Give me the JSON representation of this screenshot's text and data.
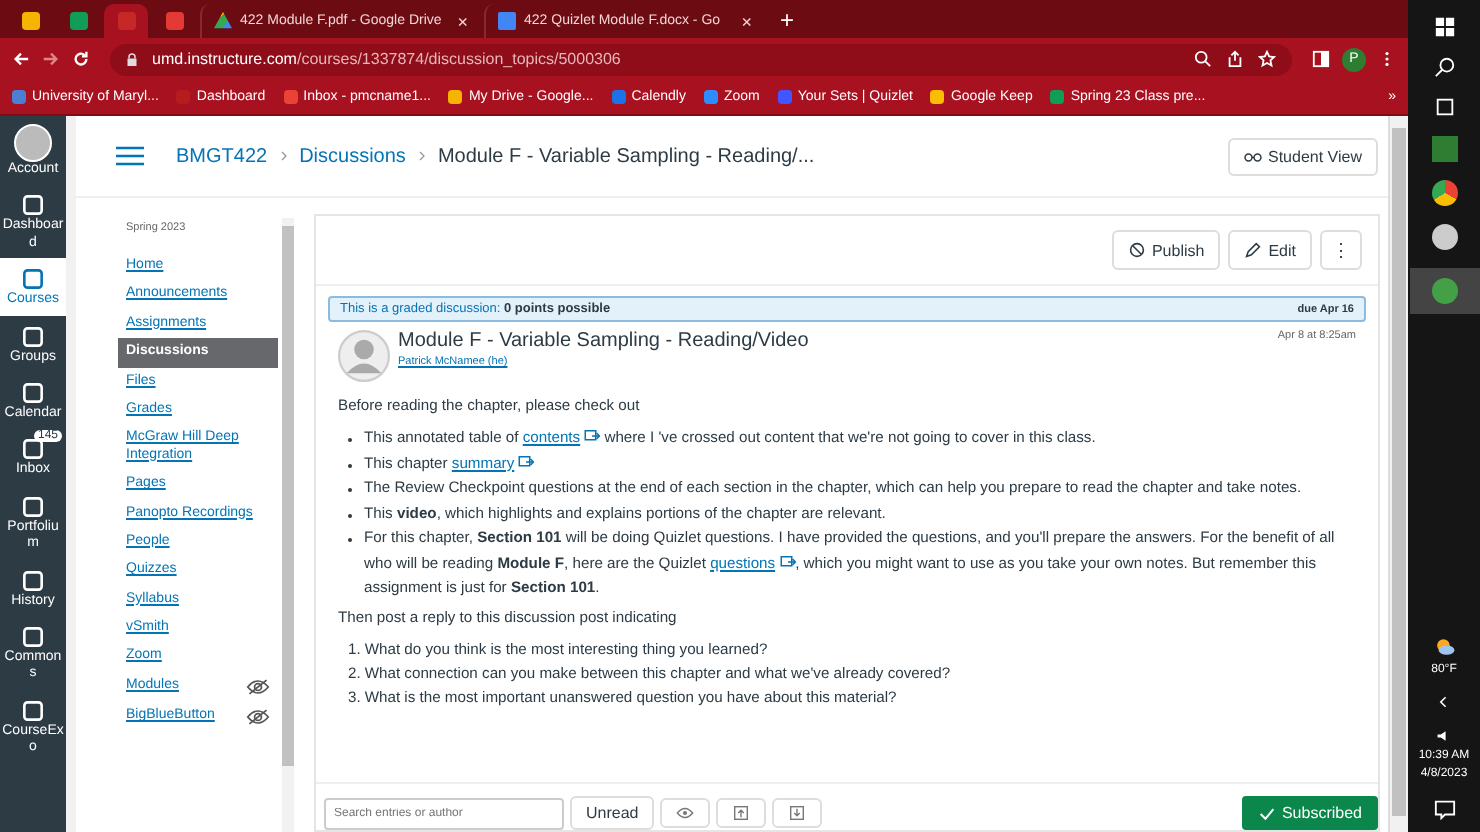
{
  "browser": {
    "tabs": [
      {
        "kind": "pinned",
        "selected": false
      },
      {
        "kind": "pinned",
        "selected": false
      },
      {
        "kind": "pinned",
        "selected": true
      },
      {
        "kind": "pinned",
        "selected": false
      },
      {
        "kind": "normal",
        "selected": false,
        "title": "422 Module F.pdf - Google Drive"
      },
      {
        "kind": "normal",
        "selected": false,
        "title": "422 Quizlet Module F.docx - Go"
      }
    ],
    "new_tab": "+",
    "close_glyph": "×",
    "address": {
      "host": "umd.instructure.com",
      "path": "/courses/1337874/discussion_topics/5000306"
    },
    "profile": "P",
    "bookmarks": [
      "University of Maryl...",
      "Dashboard",
      "Inbox - pmcname1...",
      "My Drive - Google...",
      "Calendly",
      "Zoom",
      "Your Sets | Quizlet",
      "Google Keep",
      "Spring 23 Class pre..."
    ],
    "bookmarks_more": "»"
  },
  "global_nav": [
    {
      "label": "Account",
      "selected": false
    },
    {
      "label": "Dashboard",
      "selected": false
    },
    {
      "label": "Courses",
      "selected": true
    },
    {
      "label": "Groups",
      "selected": false
    },
    {
      "label": "Calendar",
      "selected": false
    },
    {
      "label": "Inbox",
      "selected": false,
      "badge": "145"
    },
    {
      "label": "Portfolium",
      "selected": false
    },
    {
      "label": "History",
      "selected": false
    },
    {
      "label": "Commons",
      "selected": false
    },
    {
      "label": "CourseExo",
      "selected": false
    }
  ],
  "breadcrumb": [
    "BMGT422",
    "Discussions",
    "Module F - Variable Sampling - Reading/..."
  ],
  "student_view": "Student View",
  "course_nav": {
    "term": "Spring 2023",
    "items": [
      {
        "label": "Home",
        "selected": false,
        "hidden": false
      },
      {
        "label": "Announcements",
        "selected": false,
        "hidden": false
      },
      {
        "label": "Assignments",
        "selected": false,
        "hidden": false
      },
      {
        "label": "Discussions",
        "selected": true,
        "hidden": false
      },
      {
        "label": "Files",
        "selected": false,
        "hidden": false
      },
      {
        "label": "Grades",
        "selected": false,
        "hidden": false
      },
      {
        "label": "McGraw Hill Deep Integration",
        "selected": false,
        "hidden": false
      },
      {
        "label": "Pages",
        "selected": false,
        "hidden": false
      },
      {
        "label": "Panopto Recordings",
        "selected": false,
        "hidden": false
      },
      {
        "label": "People",
        "selected": false,
        "hidden": false
      },
      {
        "label": "Quizzes",
        "selected": false,
        "hidden": false
      },
      {
        "label": "Syllabus",
        "selected": false,
        "hidden": false
      },
      {
        "label": "vSmith",
        "selected": false,
        "hidden": false
      },
      {
        "label": "Zoom",
        "selected": false,
        "hidden": false
      },
      {
        "label": "Modules",
        "selected": false,
        "hidden": true
      },
      {
        "label": "BigBlueButton",
        "selected": false,
        "hidden": true
      }
    ]
  },
  "actions": {
    "publish": "Publish",
    "edit": "Edit",
    "more": "⋮"
  },
  "banner": {
    "text": "This is a graded discussion: **0 points possible**",
    "due": "due Apr 16"
  },
  "post": {
    "title": "Module F - Variable Sampling - Reading/Video",
    "author": "Patrick McNamee (he)",
    "date": "Apr 8 at 8:25am",
    "intro": "Before reading the chapter, please check out",
    "bullets": [
      [
        {
          "kind": "text",
          "text": "This annotated table of "
        },
        {
          "kind": "link",
          "text": "contents"
        },
        {
          "kind": "text",
          "text": " where I 've crossed out content that we're not going to cover in this class."
        }
      ],
      [
        {
          "kind": "text",
          "text": "This chapter "
        },
        {
          "kind": "link",
          "text": "summary"
        }
      ],
      [
        {
          "kind": "text",
          "text": "The Review Checkpoint questions at the end of each section in the chapter, which can help you prepare to read the chapter and take notes."
        }
      ],
      [
        {
          "kind": "text",
          "text": "This **video**, which highlights and explains portions of the chapter are relevant."
        }
      ],
      [
        {
          "kind": "text",
          "text": "For this chapter, **Section 101** will be doing Quizlet questions. I have provided the questions, and you'll prepare the answers.  For the benefit of all who will be reading **Module F**, here are the Quizlet "
        },
        {
          "kind": "link",
          "text": "questions"
        },
        {
          "kind": "text",
          "text": ", which you might want to use as you take your own notes.  But remember this assignment is just for **Section 101**."
        }
      ]
    ],
    "outro": "Then post a reply to this discussion post indicating",
    "questions": [
      {
        "number": "1.",
        "text": "What do you think is the most interesting thing you learned?"
      },
      {
        "number": "2.",
        "text": "What connection can you make between this chapter and what we've already covered?"
      },
      {
        "number": "3.",
        "text": "What is the most important unanswered question you have about this material?"
      }
    ]
  },
  "toolbar": {
    "search": {
      "placeholder": "Search entries or author"
    },
    "unread": "Unread",
    "subscribed": "Subscribed"
  },
  "taskbar": {
    "weather": "80°F",
    "time": "10:39 AM",
    "date": "4/8/2023"
  }
}
